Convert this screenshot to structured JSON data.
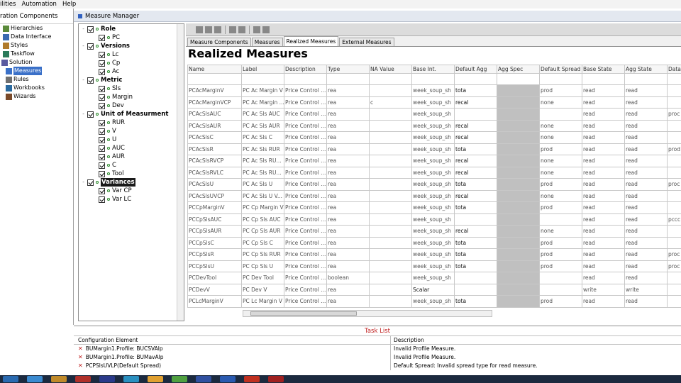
{
  "menubar": [
    "ilities",
    "Automation",
    "Help"
  ],
  "left_panel": {
    "title": "ration Components",
    "items": [
      {
        "label": "Hierarchies",
        "selected": false
      },
      {
        "label": "Data Interface",
        "selected": false
      },
      {
        "label": "Styles",
        "selected": false
      },
      {
        "label": "Taskflow",
        "selected": false
      },
      {
        "label": "Solution",
        "selected": false
      },
      {
        "label": "Measures",
        "selected": true
      },
      {
        "label": "Rules",
        "selected": false
      },
      {
        "label": "Workbooks",
        "selected": false
      },
      {
        "label": "Wizards",
        "selected": false
      }
    ]
  },
  "window_title": "Measure Manager",
  "tree": [
    {
      "label": "Role",
      "bold": true,
      "level": 0
    },
    {
      "label": "PC",
      "bold": false,
      "level": 1
    },
    {
      "label": "Versions",
      "bold": true,
      "level": 0
    },
    {
      "label": "Lc",
      "bold": false,
      "level": 1
    },
    {
      "label": "Cp",
      "bold": false,
      "level": 1
    },
    {
      "label": "Ac",
      "bold": false,
      "level": 1
    },
    {
      "label": "Metric",
      "bold": true,
      "level": 0
    },
    {
      "label": "Sls",
      "bold": false,
      "level": 1
    },
    {
      "label": "Margin",
      "bold": false,
      "level": 1
    },
    {
      "label": "Dev",
      "bold": false,
      "level": 1
    },
    {
      "label": "Unit of Measurment",
      "bold": true,
      "level": 0
    },
    {
      "label": "RUR",
      "bold": false,
      "level": 1
    },
    {
      "label": "V",
      "bold": false,
      "level": 1
    },
    {
      "label": "U",
      "bold": false,
      "level": 1
    },
    {
      "label": "AUC",
      "bold": false,
      "level": 1
    },
    {
      "label": "AUR",
      "bold": false,
      "level": 1
    },
    {
      "label": "C",
      "bold": false,
      "level": 1
    },
    {
      "label": "Tool",
      "bold": false,
      "level": 1
    },
    {
      "label": "Variances",
      "bold": true,
      "level": 0,
      "selected": true
    },
    {
      "label": "Var CP",
      "bold": false,
      "level": 1
    },
    {
      "label": "Var LC",
      "bold": false,
      "level": 1
    }
  ],
  "tabs": [
    {
      "label": "Measure Components",
      "active": false
    },
    {
      "label": "Measures",
      "active": false
    },
    {
      "label": "Realized Measures",
      "active": true
    },
    {
      "label": "External Measures",
      "active": false
    }
  ],
  "heading": "Realized Measures",
  "table": {
    "columns": [
      "Name",
      "Label",
      "Description",
      "Type",
      "NA Value",
      "Base Int.",
      "Default Agg",
      "Agg Spec",
      "Default Spread",
      "Base State",
      "Agg State",
      "Data"
    ],
    "rows": [
      [
        "PCAcMarginV",
        "PC Ac Margin V",
        "Price Control ...",
        "rea",
        "",
        "week_soup_sh",
        "tota",
        "",
        "prod",
        "read",
        "read",
        ""
      ],
      [
        "PCAcMarginVCP",
        "PC Ac Margin ...",
        "Price Control ...",
        "rea",
        "c",
        "week_soup_sh",
        "recal",
        "",
        "none",
        "read",
        "read",
        ""
      ],
      [
        "PCAcSlsAUC",
        "PC Ac Sls AUC",
        "Price Control ...",
        "rea",
        "",
        "week_soup_sh",
        "",
        "",
        "",
        "read",
        "read",
        "proc"
      ],
      [
        "PCAcSlsAUR",
        "PC Ac Sls AUR",
        "Price Control ...",
        "rea",
        "",
        "week_soup_sh",
        "recal",
        "",
        "none",
        "read",
        "read",
        ""
      ],
      [
        "PCAcSlsC",
        "PC Ac Sls C",
        "Price Control ...",
        "rea",
        "",
        "week_soup_sh",
        "recal",
        "",
        "none",
        "read",
        "read",
        ""
      ],
      [
        "PCAcSlsR",
        "PC Ac Sls RUR",
        "Price Control ...",
        "rea",
        "",
        "week_soup_sh",
        "tota",
        "",
        "prod",
        "read",
        "read",
        "prod"
      ],
      [
        "PCAcSlsRVCP",
        "PC Ac Sls RU...",
        "Price Control ...",
        "rea",
        "",
        "week_soup_sh",
        "recal",
        "",
        "none",
        "read",
        "read",
        ""
      ],
      [
        "PCAcSlsRVLC",
        "PC Ac Sls RU...",
        "Price Control ...",
        "rea",
        "",
        "week_soup_sh",
        "recal",
        "",
        "none",
        "read",
        "read",
        ""
      ],
      [
        "PCAcSlsU",
        "PC Ac Sls U",
        "Price Control ...",
        "rea",
        "",
        "week_soup_sh",
        "tota",
        "",
        "prod",
        "read",
        "read",
        "proc"
      ],
      [
        "PCAcSlsUVCP",
        "PC Ac Sls U V...",
        "Price Control ...",
        "rea",
        "",
        "week_soup_sh",
        "recal",
        "",
        "none",
        "read",
        "read",
        ""
      ],
      [
        "PCCpMarginV",
        "PC Cp Margin V",
        "Price Control ...",
        "rea",
        "",
        "week_soup_sh",
        "tota",
        "",
        "prod",
        "read",
        "read",
        ""
      ],
      [
        "PCCpSlsAUC",
        "PC Cp Sls AUC",
        "Price Control ...",
        "rea",
        "",
        "week_soup_sh",
        "",
        "",
        "",
        "read",
        "read",
        "pccc"
      ],
      [
        "PCCpSlsAUR",
        "PC Cp Sls AUR",
        "Price Control ...",
        "rea",
        "",
        "week_soup_sh",
        "recal",
        "",
        "none",
        "read",
        "read",
        ""
      ],
      [
        "PCCpSlsC",
        "PC Cp Sls C",
        "Price Control ...",
        "rea",
        "",
        "week_soup_sh",
        "tota",
        "",
        "prod",
        "read",
        "read",
        ""
      ],
      [
        "PCCpSlsR",
        "PC Cp Sls RUR",
        "Price Control ...",
        "rea",
        "",
        "week_soup_sh",
        "tota",
        "",
        "prod",
        "read",
        "read",
        "proc"
      ],
      [
        "PCCpSlsU",
        "PC Cp Sls U",
        "Price Control ...",
        "rea",
        "",
        "week_soup_sh",
        "tota",
        "",
        "prod",
        "read",
        "read",
        "proc"
      ],
      [
        "PCDevTool",
        "PC Dev Tool",
        "Price Control ...",
        "boolean",
        "",
        "week_soup_sh",
        "",
        "",
        "",
        "read",
        "read",
        ""
      ],
      [
        "PCDevV",
        "PC Dev V",
        "Price Control ...",
        "rea",
        "",
        "Scalar",
        "",
        "",
        "",
        "write",
        "write",
        ""
      ],
      [
        "PCLcMarginV",
        "PC Lc Margin V",
        "Price Control ...",
        "rea",
        "",
        "week_soup_sh",
        "tota",
        "",
        "prod",
        "read",
        "read",
        ""
      ]
    ]
  },
  "task_list": {
    "title": "Task List",
    "headers": [
      "Configuration Element",
      "Description"
    ],
    "rows": [
      {
        "element": "BUMargin1.Profile: BUCSVAlp",
        "description": "Invalid Profile Measure."
      },
      {
        "element": "BUMargin1.Profile: BUMavAlp",
        "description": "Invalid Profile Measure."
      },
      {
        "element": "PCPSlsUVLP(Default Spread)",
        "description": "Default Spread: Invalid spread type for read measure."
      }
    ]
  },
  "colors": {
    "accent": "#3a70c8",
    "tasklist_title": "#c02020",
    "taskbar": "#1c2a3f"
  }
}
